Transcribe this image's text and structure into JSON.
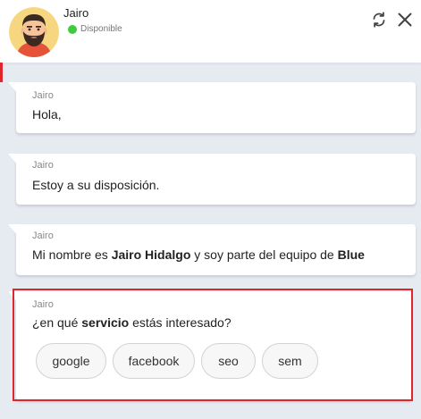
{
  "header": {
    "agent_name": "Jairo",
    "status_text": "Disponible",
    "status_color": "#3ecb3e",
    "icons": [
      "refresh-icon",
      "close-icon"
    ]
  },
  "messages": [
    {
      "sender": "Jairo",
      "text": "Hola,"
    },
    {
      "sender": "Jairo",
      "text": "Estoy a su disposición."
    },
    {
      "sender": "Jairo",
      "text_parts": [
        "Mi nombre es ",
        "Jairo Hidalgo",
        " y soy parte del equipo de ",
        "Blue"
      ]
    },
    {
      "sender": "Jairo",
      "text_parts": [
        "¿en qué ",
        "servicio",
        " estás interesado?"
      ],
      "options": [
        "google",
        "facebook",
        "seo",
        "sem"
      ]
    }
  ],
  "colors": {
    "accent_red": "#e0262d",
    "background": "#e6ebf2",
    "bubble": "#ffffff"
  }
}
